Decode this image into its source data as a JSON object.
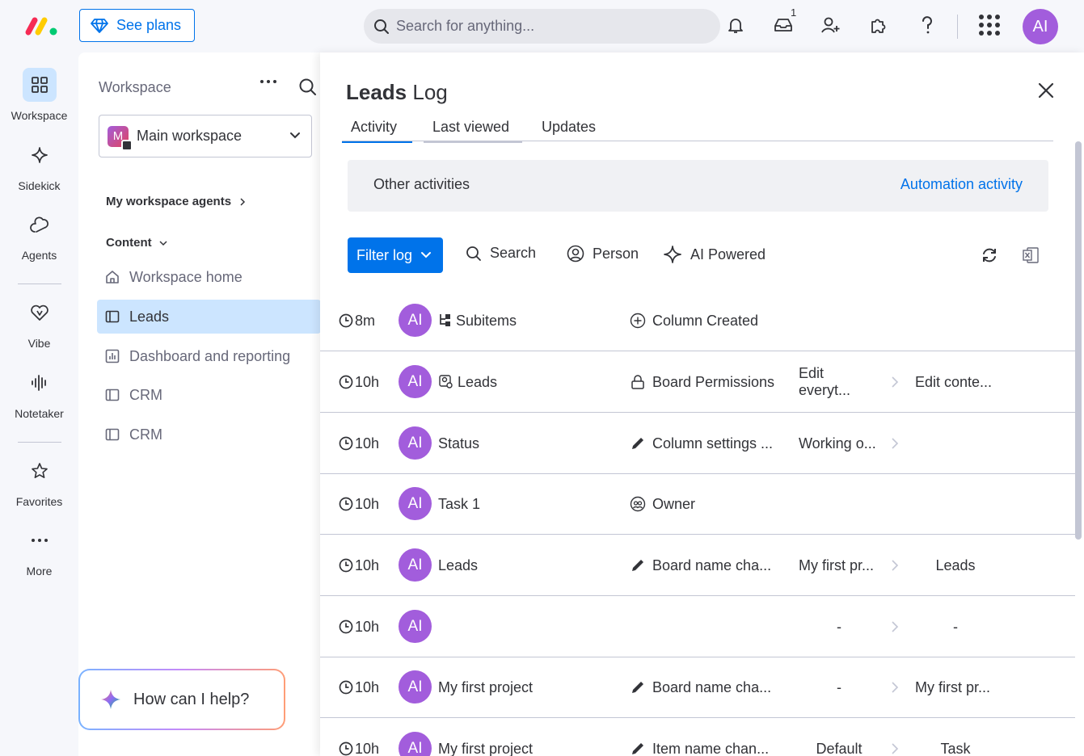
{
  "topbar": {
    "see_plans": "See plans",
    "search_placeholder": "Search for anything...",
    "inbox_count": "1",
    "avatar": "AI",
    "icons": [
      "bell-icon",
      "inbox-icon",
      "invite-icon",
      "puzzle-icon",
      "help-icon",
      "apps-grid-icon"
    ]
  },
  "rail": {
    "items": [
      {
        "label": "Workspace",
        "icon": "grid-icon"
      },
      {
        "label": "Sidekick",
        "icon": "sparkle-icon"
      },
      {
        "label": "Agents",
        "icon": "agents-icon"
      },
      {
        "label": "Vibe",
        "icon": "heart-icon"
      },
      {
        "label": "Notetaker",
        "icon": "waveform-icon"
      },
      {
        "label": "Favorites",
        "icon": "star-icon"
      },
      {
        "label": "More",
        "icon": "dots-icon"
      }
    ]
  },
  "workspace": {
    "title": "Workspace",
    "selected": "Main workspace",
    "selected_initial": "M",
    "agents_label": "My workspace agents",
    "content_label": "Content",
    "items": [
      {
        "label": "Workspace home"
      },
      {
        "label": "Leads"
      },
      {
        "label": "Dashboard and reporting"
      },
      {
        "label": "CRM"
      },
      {
        "label": "CRM"
      }
    ],
    "help": "How can I help?"
  },
  "log": {
    "title_bold": "Leads",
    "title_rest": "Log",
    "tabs": [
      "Activity",
      "Last viewed",
      "Updates"
    ],
    "other_activities": "Other activities",
    "automation_activity": "Automation activity",
    "filter_log": "Filter log",
    "search": "Search",
    "person": "Person",
    "ai_powered": "AI Powered",
    "rows": [
      {
        "time": "8m",
        "avatar": "AI",
        "name": "Subitems",
        "action": "Column Created",
        "from": "",
        "to": ""
      },
      {
        "time": "10h",
        "avatar": "AI",
        "name": "Leads",
        "action": "Board Permissions",
        "from": "Edit everyt...",
        "to": "Edit conte..."
      },
      {
        "time": "10h",
        "avatar": "AI",
        "name": "Status",
        "action": "Column settings ...",
        "from": "Working o...",
        "to": ""
      },
      {
        "time": "10h",
        "avatar": "AI",
        "name": "Task 1",
        "action": "Owner",
        "from": "",
        "to": ""
      },
      {
        "time": "10h",
        "avatar": "AI",
        "name": "Leads",
        "action": "Board name cha...",
        "from": "My first pr...",
        "to": "Leads"
      },
      {
        "time": "10h",
        "avatar": "AI",
        "name": "",
        "action": "",
        "from": "-",
        "to": "-"
      },
      {
        "time": "10h",
        "avatar": "AI",
        "name": "My first project",
        "action": "Board name cha...",
        "from": "-",
        "to": "My first pr..."
      },
      {
        "time": "10h",
        "avatar": "AI",
        "name": "My first project",
        "action": "Item name chan...",
        "from": "Default",
        "to": "Task"
      }
    ]
  }
}
